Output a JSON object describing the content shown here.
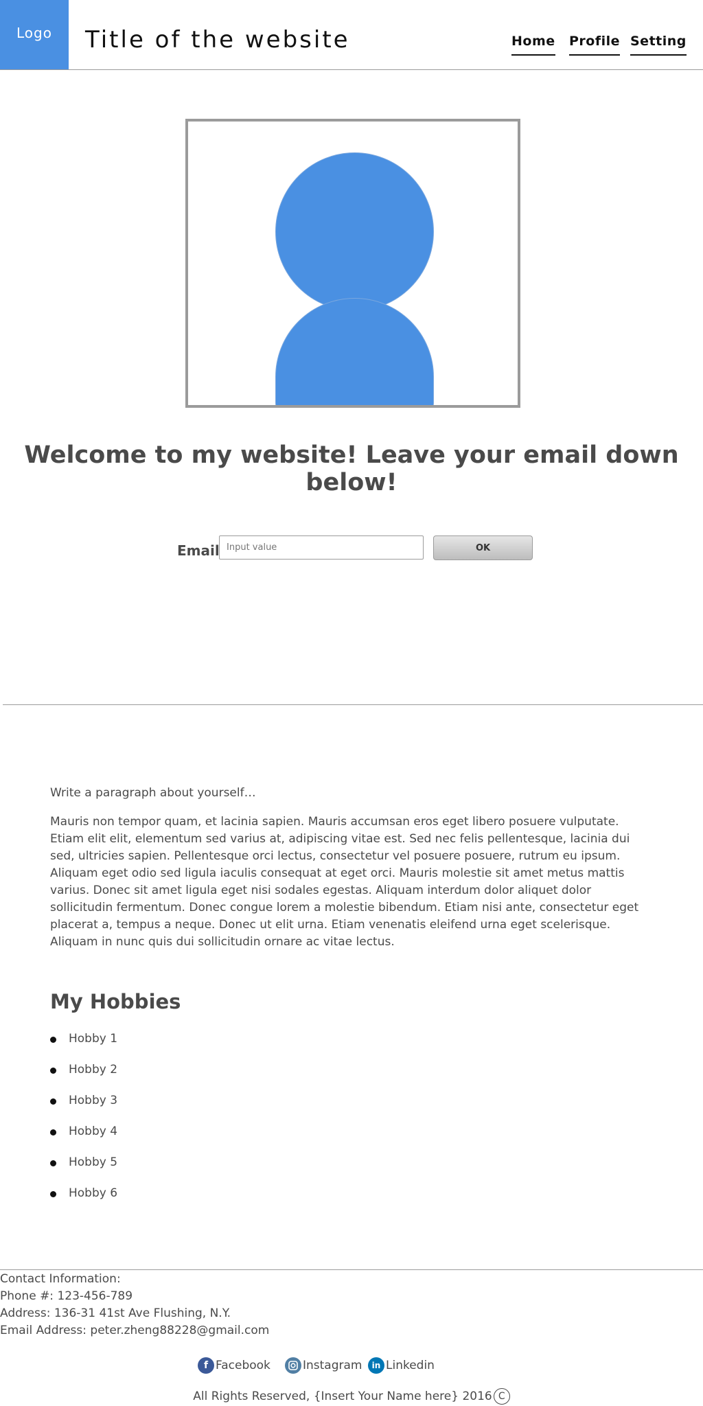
{
  "header": {
    "logo": "Logo",
    "title": "Title of the website",
    "nav": [
      "Home",
      "Profile",
      "Setting"
    ]
  },
  "welcome": "Welcome to my website! Leave your email down below!",
  "signup": {
    "label": "Email:",
    "placeholder": "Input value",
    "button": "OK"
  },
  "about": {
    "intro": "Write a paragraph about yourself…",
    "paragraph": "Mauris non tempor quam, et lacinia sapien. Mauris accumsan eros eget libero posuere vulputate. Etiam elit elit, elementum sed varius at, adipiscing vitae est. Sed nec felis pellentesque, lacinia dui sed, ultricies sapien. Pellentesque orci lectus, consectetur vel posuere posuere, rutrum eu ipsum. Aliquam eget odio sed ligula iaculis consequat at eget orci. Mauris molestie sit amet metus mattis varius. Donec sit amet ligula eget nisi sodales egestas. Aliquam interdum dolor aliquet dolor sollicitudin fermentum. Donec congue lorem a molestie bibendum. Etiam nisi ante, consectetur eget placerat a, tempus a neque. Donec ut elit urna. Etiam venenatis eleifend urna eget scelerisque. Aliquam in nunc quis dui sollicitudin ornare ac vitae lectus."
  },
  "hobbies": {
    "title": "My Hobbies",
    "items": [
      "Hobby 1",
      "Hobby 2",
      "Hobby 3",
      "Hobby 4",
      "Hobby 5",
      "Hobby 6"
    ]
  },
  "contact": {
    "heading": "Contact Information:",
    "phone": "Phone #: 123-456-789",
    "address": "Address: 136-31 41st Ave Flushing, N.Y.",
    "email": "Email Address: peter.zheng88228@gmail.com"
  },
  "social": {
    "facebook": "Facebook",
    "instagram": "Instagram",
    "linkedin": "Linkedin",
    "facebook_glyph": "f",
    "linkedin_glyph": "in"
  },
  "footer": {
    "copyright": "All Rights Reserved, {Insert Your Name here} 2016",
    "copyright_symbol": "C"
  },
  "colors": {
    "accent": "#4a90e2",
    "text": "#4a4a4a",
    "border": "#9b9b9b"
  },
  "icons": [
    "avatar-icon",
    "facebook-icon",
    "instagram-icon",
    "linkedin-icon",
    "copyright-icon"
  ]
}
